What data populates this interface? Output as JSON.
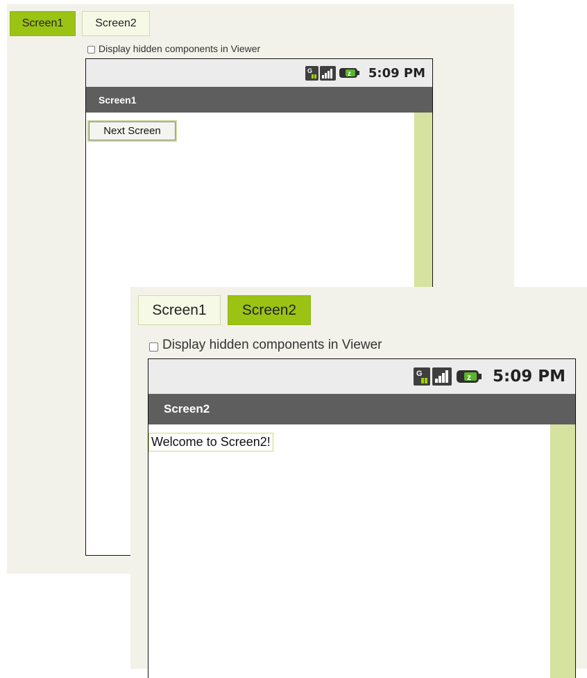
{
  "screen1_panel": {
    "tabs": [
      {
        "label": "Screen1",
        "active": true
      },
      {
        "label": "Screen2",
        "active": false
      }
    ],
    "checkbox_label": "Display hidden components in Viewer",
    "status_time": "5:09 PM",
    "title": "Screen1",
    "button_label": "Next Screen"
  },
  "screen2_panel": {
    "tabs": [
      {
        "label": "Screen1",
        "active": false
      },
      {
        "label": "Screen2",
        "active": true
      }
    ],
    "checkbox_label": "Display hidden components in Viewer",
    "status_time": "5:09 PM",
    "title": "Screen2",
    "label_text": "Welcome to Screen2!"
  },
  "colors": {
    "active_tab": "#9bc314",
    "inactive_tab": "#f6f9e6",
    "panel_bg": "#f2f2ea",
    "title_bar": "#5e5e5e",
    "status_bar": "#ececec",
    "scrollbar": "#d5e2a0"
  },
  "status_icons": [
    "network-type-icon",
    "signal-strength-icon",
    "battery-icon"
  ]
}
